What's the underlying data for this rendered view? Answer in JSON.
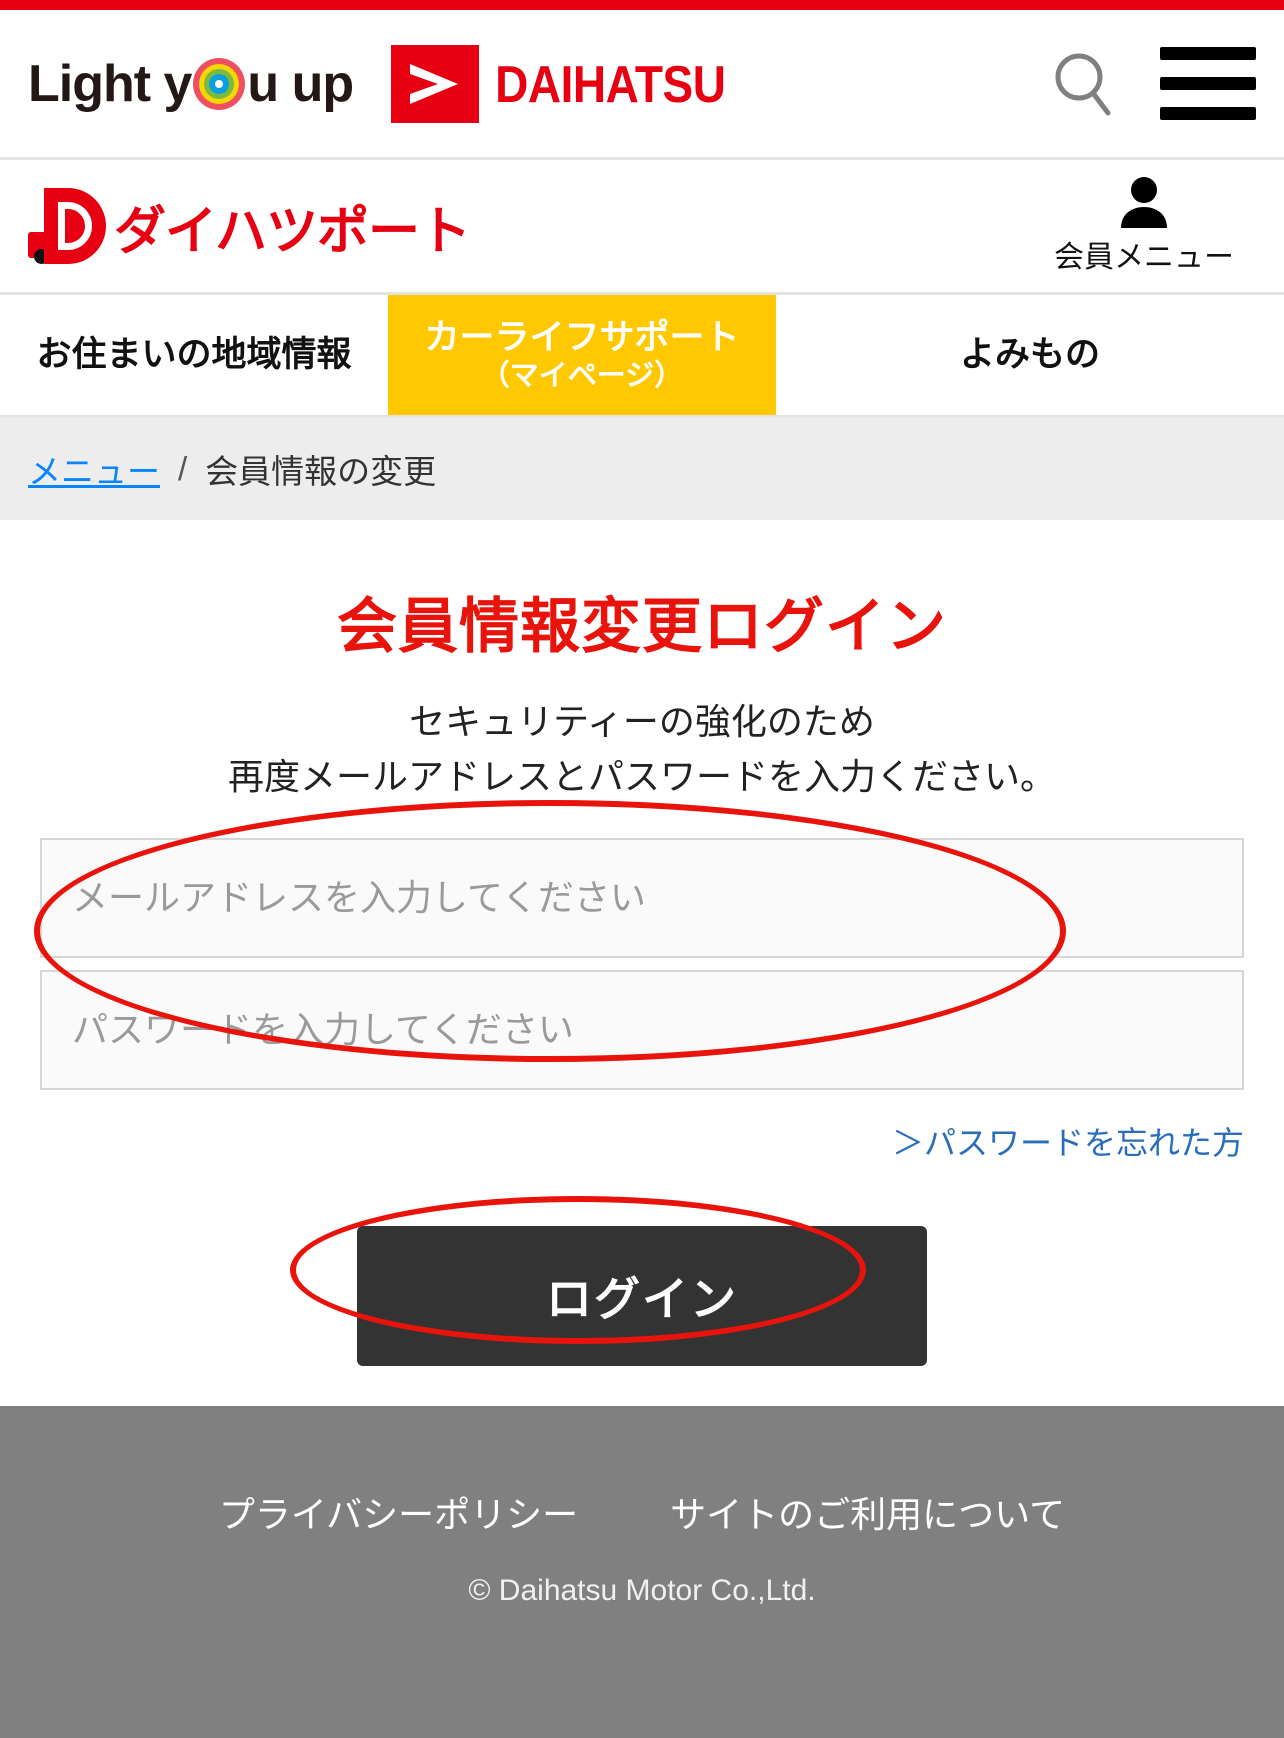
{
  "header": {
    "brand_slogan": "Light you up",
    "brand_name": "DAIHATSU",
    "search_icon": "search-icon",
    "menu_icon": "hamburger-menu-icon"
  },
  "port_bar": {
    "logo_text": "ダイハツポート",
    "member_menu_label": "会員メニュー",
    "member_icon": "person-icon"
  },
  "tabs": [
    {
      "label": "お住まいの地域情報",
      "sub": "",
      "active": false
    },
    {
      "label": "カーライフサポート",
      "sub": "（マイページ）",
      "active": true
    },
    {
      "label": "よみもの",
      "sub": "",
      "active": false
    }
  ],
  "breadcrumb": {
    "home_label": "メニュー",
    "separator": "/",
    "current_label": "会員情報の変更"
  },
  "main": {
    "title": "会員情報変更ログイン",
    "lead_line1": "セキュリティーの強化のため",
    "lead_line2": "再度メールアドレスとパスワードを入力ください。",
    "email_placeholder": "メールアドレスを入力してください",
    "email_value": "",
    "password_placeholder": "パスワードを入力してください",
    "password_value": "",
    "forgot_password_label": "＞パスワードを忘れた方",
    "login_button_label": "ログイン"
  },
  "footer": {
    "links": [
      {
        "label": "プライバシーポリシー"
      },
      {
        "label": "サイトのご利用について"
      }
    ],
    "copyright": "© Daihatsu Motor Co.,Ltd."
  },
  "colors": {
    "brand_red": "#e60012",
    "title_red": "#e8140c",
    "tab_active_yellow": "#ffc800",
    "link_blue": "#0a84ff",
    "button_dark": "#333333",
    "footer_gray": "#808080",
    "annotation_red": "#e8140c"
  }
}
